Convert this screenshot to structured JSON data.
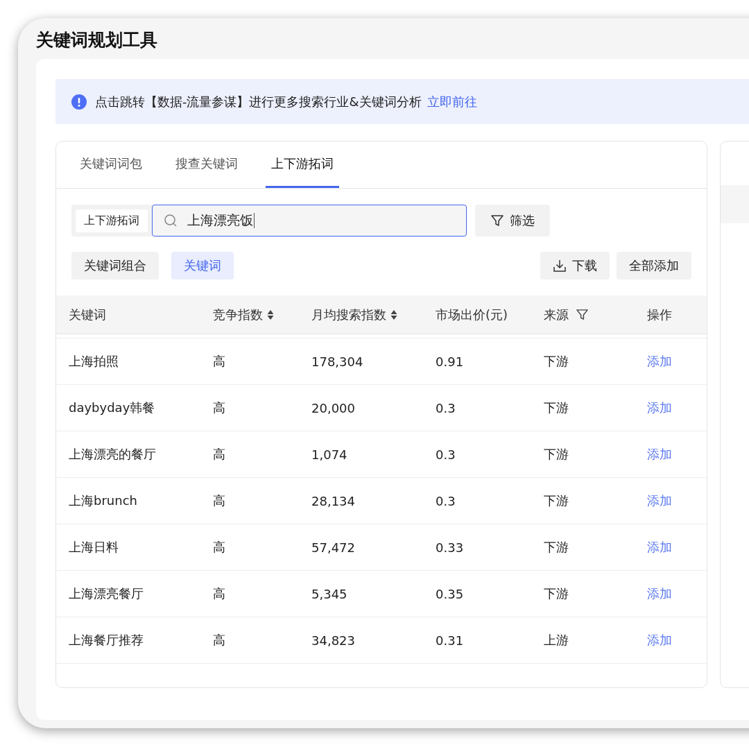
{
  "window": {
    "title": "关键词规划工具"
  },
  "notice": {
    "text": "点击跳转【数据-流量参谋】进行更多搜索行业&关键词分析",
    "link": "立即前往"
  },
  "tabs": [
    {
      "label": "关键词词包",
      "selected": false
    },
    {
      "label": "搜查关键词",
      "selected": false
    },
    {
      "label": "上下游拓词",
      "selected": true
    }
  ],
  "search": {
    "mode": "上下游拓词",
    "value": "上海漂亮饭",
    "filter_button": "筛选"
  },
  "view_toggle": [
    {
      "label": "关键词组合",
      "selected": false
    },
    {
      "label": "关键词",
      "selected": true
    }
  ],
  "actions": {
    "download": "下载",
    "add_all": "全部添加"
  },
  "table": {
    "columns": [
      {
        "label": "关键词",
        "kind": "plain"
      },
      {
        "label": "竞争指数",
        "kind": "sort"
      },
      {
        "label": "月均搜索指数",
        "kind": "sort"
      },
      {
        "label": "市场出价(元)",
        "kind": "plain"
      },
      {
        "label": "来源",
        "kind": "filter"
      },
      {
        "label": "操作",
        "kind": "plain"
      }
    ],
    "rows": [
      {
        "keyword": "上海拍照",
        "competition": "高",
        "monthly": "178,304",
        "price": "0.91",
        "source": "下游",
        "action": "添加"
      },
      {
        "keyword": "daybyday韩餐",
        "competition": "高",
        "monthly": "20,000",
        "price": "0.3",
        "source": "下游",
        "action": "添加"
      },
      {
        "keyword": "上海漂亮的餐厅",
        "competition": "高",
        "monthly": "1,074",
        "price": "0.3",
        "source": "下游",
        "action": "添加"
      },
      {
        "keyword": "上海brunch",
        "competition": "高",
        "monthly": "28,134",
        "price": "0.3",
        "source": "下游",
        "action": "添加"
      },
      {
        "keyword": "上海日料",
        "competition": "高",
        "monthly": "57,472",
        "price": "0.33",
        "source": "下游",
        "action": "添加"
      },
      {
        "keyword": "上海漂亮餐厅",
        "competition": "高",
        "monthly": "5,345",
        "price": "0.35",
        "source": "下游",
        "action": "添加"
      },
      {
        "keyword": "上海餐厅推荐",
        "competition": "高",
        "monthly": "34,823",
        "price": "0.31",
        "source": "上游",
        "action": "添加"
      }
    ]
  }
}
